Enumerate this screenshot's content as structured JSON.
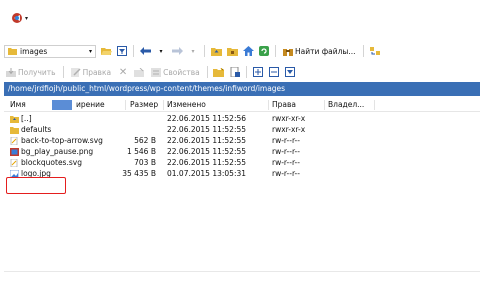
{
  "toolbar": {
    "path_combo_value": "images",
    "find_files_label": "Найти файлы...",
    "get_label": "Получить",
    "edit_label": "Правка",
    "properties_label": "Свойства"
  },
  "path_bar": "/home/jrdfiojh/public_html/wordpress/wp-content/themes/infiword/images",
  "columns": {
    "name": "Имя",
    "ext": "ирение",
    "size": "Размер",
    "modified": "Изменено",
    "rights": "Права",
    "owner": "Владел..."
  },
  "files": [
    {
      "name": "[..]",
      "size": "",
      "modified": "22.06.2015 11:52:56",
      "rights": "rwxr-xr-x",
      "icon": "folder-up-icon"
    },
    {
      "name": "defaults",
      "size": "",
      "modified": "22.06.2015 11:52:55",
      "rights": "rwxr-xr-x",
      "icon": "folder-icon"
    },
    {
      "name": "back-to-top-arrow.svg",
      "size": "562 B",
      "modified": "22.06.2015 11:52:55",
      "rights": "rw-r--r--",
      "icon": "svg-file-icon"
    },
    {
      "name": "bg_play_pause.png",
      "size": "1 546 B",
      "modified": "22.06.2015 11:52:55",
      "rights": "rw-r--r--",
      "icon": "png-file-icon"
    },
    {
      "name": "blockquotes.svg",
      "size": "703 B",
      "modified": "22.06.2015 11:52:55",
      "rights": "rw-r--r--",
      "icon": "svg-file-icon"
    },
    {
      "name": "logo.jpg",
      "size": "35 435 B",
      "modified": "01.07.2015 13:05:31",
      "rights": "rw-r--r--",
      "icon": "jpg-file-icon"
    }
  ],
  "colors": {
    "path_bar_bg": "#3a6fb5",
    "highlight": "#e41e1e"
  }
}
